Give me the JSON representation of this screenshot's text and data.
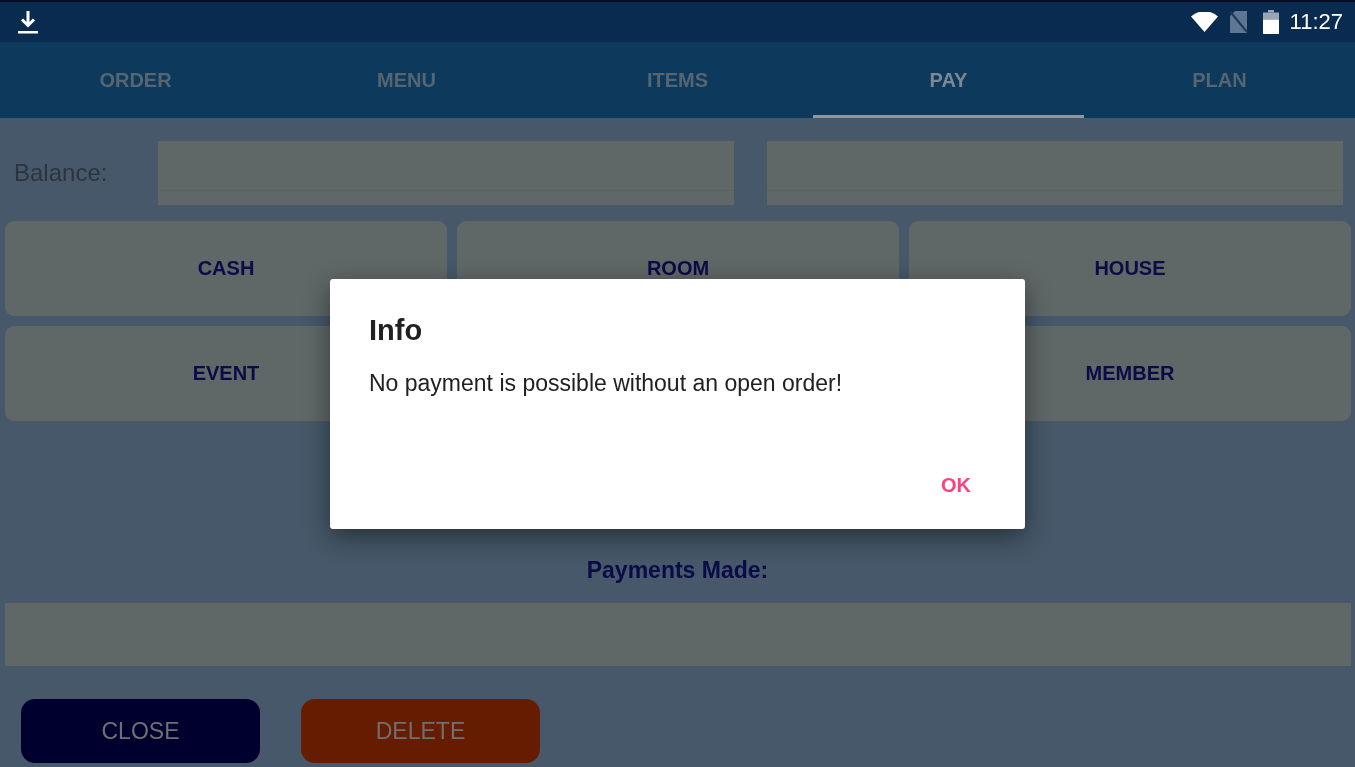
{
  "status_bar": {
    "time": "11:27"
  },
  "tabs": [
    {
      "label": "ORDER",
      "selected": false
    },
    {
      "label": "MENU",
      "selected": false
    },
    {
      "label": "ITEMS",
      "selected": false
    },
    {
      "label": "PAY",
      "selected": true
    },
    {
      "label": "PLAN",
      "selected": false
    }
  ],
  "balance": {
    "label": "Balance:"
  },
  "payment_method_rows": [
    [
      "CASH",
      "ROOM",
      "HOUSE"
    ],
    [
      "EVENT",
      "MEMBER"
    ]
  ],
  "payments": {
    "heading": "Payments Made:"
  },
  "actions": [
    {
      "label": "CLOSE",
      "kind": "close"
    },
    {
      "label": "DELETE",
      "kind": "delete"
    }
  ],
  "dialog": {
    "title": "Info",
    "message": "No payment is possible without an open order!",
    "buttons": [
      "OK"
    ]
  }
}
